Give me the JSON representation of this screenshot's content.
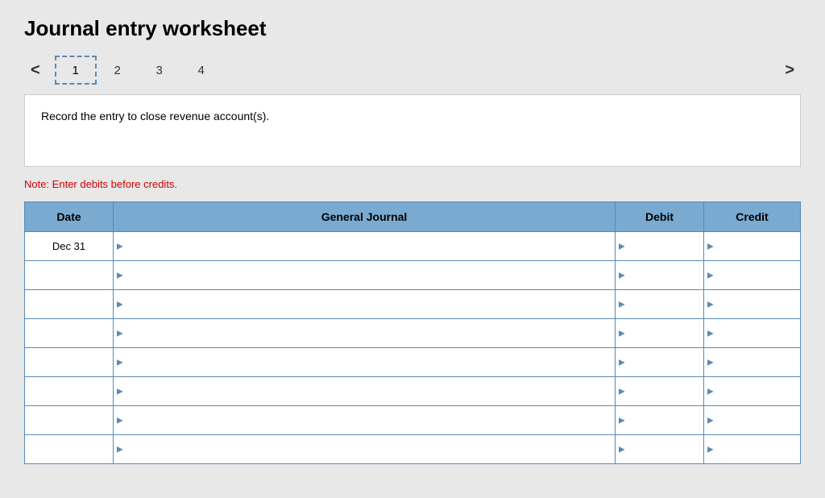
{
  "title": "Journal entry worksheet",
  "nav": {
    "prev_arrow": "<",
    "next_arrow": ">",
    "tabs": [
      {
        "label": "1",
        "active": true
      },
      {
        "label": "2",
        "active": false
      },
      {
        "label": "3",
        "active": false
      },
      {
        "label": "4",
        "active": false
      }
    ]
  },
  "instruction": "Record the entry to close revenue account(s).",
  "note": "Note: Enter debits before credits.",
  "table": {
    "headers": {
      "date": "Date",
      "journal": "General Journal",
      "debit": "Debit",
      "credit": "Credit"
    },
    "rows": [
      {
        "date": "Dec 31",
        "journal": "",
        "debit": "",
        "credit": ""
      },
      {
        "date": "",
        "journal": "",
        "debit": "",
        "credit": ""
      },
      {
        "date": "",
        "journal": "",
        "debit": "",
        "credit": ""
      },
      {
        "date": "",
        "journal": "",
        "debit": "",
        "credit": ""
      },
      {
        "date": "",
        "journal": "",
        "debit": "",
        "credit": ""
      },
      {
        "date": "",
        "journal": "",
        "debit": "",
        "credit": ""
      },
      {
        "date": "",
        "journal": "",
        "debit": "",
        "credit": ""
      },
      {
        "date": "",
        "journal": "",
        "debit": "",
        "credit": ""
      }
    ]
  }
}
